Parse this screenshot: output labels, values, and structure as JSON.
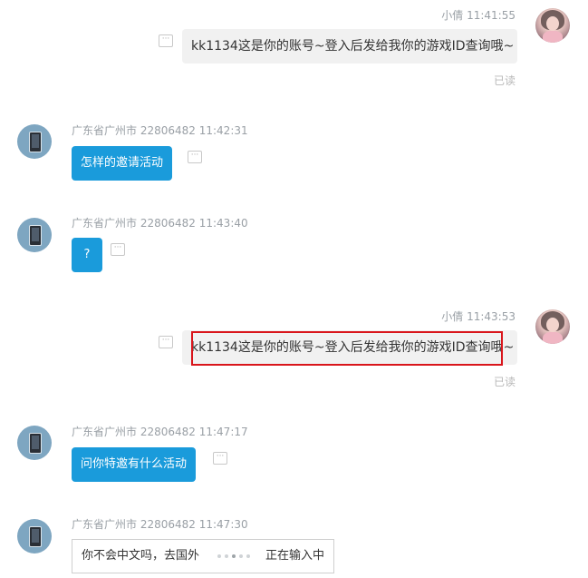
{
  "messages": [
    {
      "sender": "小倩",
      "time": "11:41:55",
      "text": "kk1134这是你的账号~登入后发给我你的游戏ID查询哦~",
      "status": "已读"
    },
    {
      "sender": "广东省广州市 22806482",
      "time": "11:42:31",
      "text": "怎样的邀请活动"
    },
    {
      "sender": "广东省广州市 22806482",
      "time": "11:43:40",
      "text": "?"
    },
    {
      "sender": "小倩",
      "time": "11:43:53",
      "text": "kk1134这是你的账号~登入后发给我你的游戏ID查询哦~",
      "status": "已读"
    },
    {
      "sender": "广东省广州市 22806482",
      "time": "11:47:17",
      "text": "问你特邀有什么活动"
    },
    {
      "sender": "广东省广州市 22806482",
      "time": "11:47:30",
      "text": "你不会中文吗，去国外"
    }
  ],
  "typing_label": "正在输入中",
  "more_icon": "ellipsis-icon",
  "colors": {
    "visitor_bubble": "#1a9bdb",
    "agent_bubble": "#f1f1f1",
    "highlight": "#d9151b"
  }
}
